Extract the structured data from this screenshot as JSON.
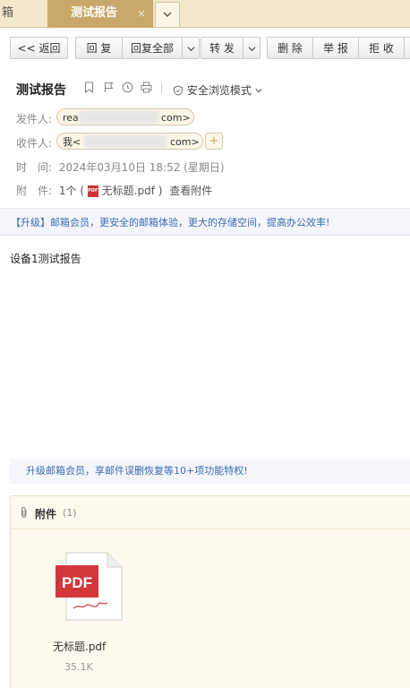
{
  "tabs": {
    "prev_label": "箱",
    "active_label": "测试报告",
    "close_glyph": "×",
    "more_glyph": "⌄"
  },
  "toolbar": {
    "back": "<< 返回",
    "reply": "回 复",
    "reply_all": "回复全部",
    "forward": "转 发",
    "delete": "删 除",
    "report": "举 报",
    "reject": "拒 收",
    "dropdown_glyph": "⌄"
  },
  "message": {
    "subject": "测试报告",
    "safe_mode": "安全浏览模式",
    "from_label": "发件人:",
    "from_value_start": "rea",
    "from_value_end": "com>",
    "to_label": "收件人:",
    "to_value_start": "我<",
    "to_value_end": "com>",
    "time_label": "时　间:",
    "time_value": "2024年03月10日 18:52 (星期日)",
    "attach_label": "附　件:",
    "attach_count": "1个 (",
    "attach_name": "无标题.pdf",
    "attach_close": ")",
    "view_attach": "查看附件",
    "add_glyph": "+"
  },
  "banner_top": "【升级】邮箱会员，更安全的邮箱体验，更大的存储空间，提高办公效率!",
  "body_text": "设备1测试报告",
  "banner_bottom": "升级邮箱会员，享邮件误删恢复等10+项功能特权!",
  "attachments": {
    "title": "附件",
    "count": "(1)",
    "items": [
      {
        "name": "无标题.pdf",
        "size": "35.1K",
        "badge": "PDF"
      }
    ]
  },
  "icons": {
    "bookmark": "bookmark-icon",
    "flag": "flag-icon",
    "clock": "clock-icon",
    "print": "print-icon",
    "shield": "shield-icon",
    "paperclip": "paperclip-icon"
  },
  "colors": {
    "tab_active": "#c8a86a",
    "link_blue": "#3c6ab3",
    "pdf_red": "#d2373c"
  }
}
